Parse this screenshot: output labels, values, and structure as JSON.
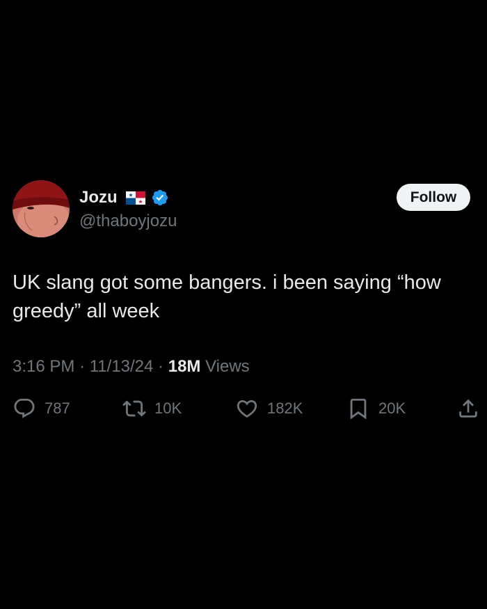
{
  "user": {
    "display_name": "Jozu",
    "handle": "@thaboyjozu",
    "flag": "panama-flag",
    "verified_icon": "verified-badge-icon",
    "verified_color": "#1d9bf0"
  },
  "follow_button": {
    "label": "Follow"
  },
  "tweet": {
    "text": "UK slang got some bangers. i been saying “how greedy” all week",
    "time": "3:16 PM",
    "date": "11/13/24",
    "separator": "·",
    "views_count": "18M",
    "views_label": "Views"
  },
  "actions": {
    "replies": "787",
    "retweets": "10K",
    "likes": "182K",
    "bookmarks": "20K"
  },
  "colors": {
    "background": "#000000",
    "primary_text": "#e7e9ea",
    "secondary_text": "#71767b",
    "accent": "#1d9bf0"
  }
}
